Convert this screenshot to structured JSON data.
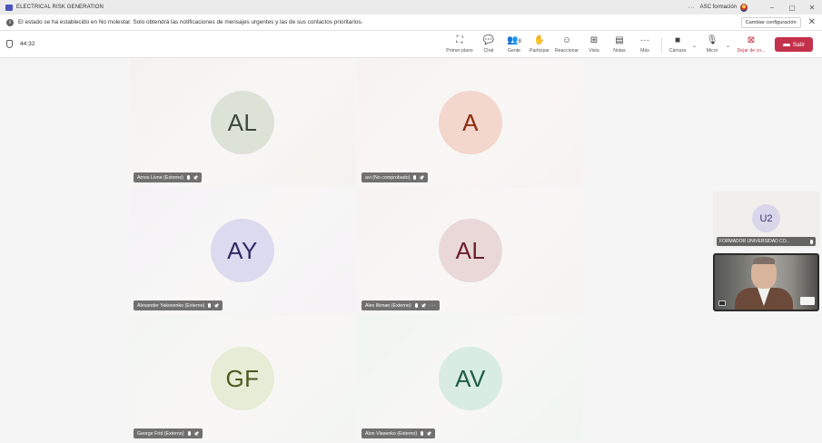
{
  "window": {
    "title": "ELECTRICAL RISK GENERATION",
    "more": "···",
    "org_name": "ASC formación",
    "minimize": "−",
    "restore": "▢",
    "close": "✕"
  },
  "notification": {
    "info_icon": "i",
    "message": "El estado se ha establecido en No molestar. Solo obtendrá las notificaciones de mensajes urgentes y las de sus contactos prioritarios.",
    "change_button": "Cambiar configuración",
    "close": "✕"
  },
  "toolbar": {
    "timer": "44:32",
    "items": [
      {
        "label": "Primer plano",
        "icon": "focus-icon",
        "glyph": "⛶"
      },
      {
        "label": "Chat",
        "icon": "chat-icon",
        "glyph": "💬"
      },
      {
        "label": "Gente",
        "icon": "people-icon",
        "glyph": "👥",
        "count": "8"
      },
      {
        "label": "Participar",
        "icon": "raise-hand-icon",
        "glyph": "✋"
      },
      {
        "label": "Reaccionar",
        "icon": "react-icon",
        "glyph": "☺"
      },
      {
        "label": "Vista",
        "icon": "view-icon",
        "glyph": "⊞"
      },
      {
        "label": "Notas",
        "icon": "notes-icon",
        "glyph": "▤"
      },
      {
        "label": "Más",
        "icon": "more-icon",
        "glyph": "···"
      },
      {
        "label": "Cámara",
        "icon": "camera-icon",
        "glyph": "■"
      },
      {
        "label": "Micro",
        "icon": "mic-icon",
        "glyph": "🎙"
      },
      {
        "label": "Dejar de co...",
        "icon": "stop-share-icon",
        "glyph": "⊠"
      }
    ],
    "chevron": "⌄",
    "leave_label": "Salir"
  },
  "participants": [
    {
      "initials": "AL",
      "name": "Amos Livne (Externo)",
      "bg": "#f4f2ee",
      "avatar_bg": "#dde2d7",
      "avatar_fg": "#3b4a36"
    },
    {
      "initials": "A",
      "name": "avi (No comprobado)",
      "bg": "#f7f2f1",
      "avatar_bg": "#f3d6cc",
      "avatar_fg": "#8a2a0f"
    },
    {
      "initials": "AY",
      "name": "Alexander Yakovenko (Externo)",
      "bg": "#f4f2f5",
      "avatar_bg": "#dcdaee",
      "avatar_fg": "#2d2a68"
    },
    {
      "initials": "AL",
      "name": "Alex Ilkman (Externo)",
      "bg": "#f6f3f2",
      "avatar_bg": "#ead8d8",
      "avatar_fg": "#6a1f2a",
      "more": "···"
    },
    {
      "initials": "GF",
      "name": "George Frid (Externo)",
      "bg": "#f3f5f0",
      "avatar_bg": "#e6ecd5",
      "avatar_fg": "#4a5a21"
    },
    {
      "initials": "AV",
      "name": "Alon Vlasenko (Externo)",
      "bg": "#eff5f1",
      "avatar_bg": "#d9ece3",
      "avatar_fg": "#1f5c46"
    }
  ],
  "side_participant": {
    "initials": "U2",
    "name": "FORMADOR UNIVERSIDAD CO..."
  }
}
